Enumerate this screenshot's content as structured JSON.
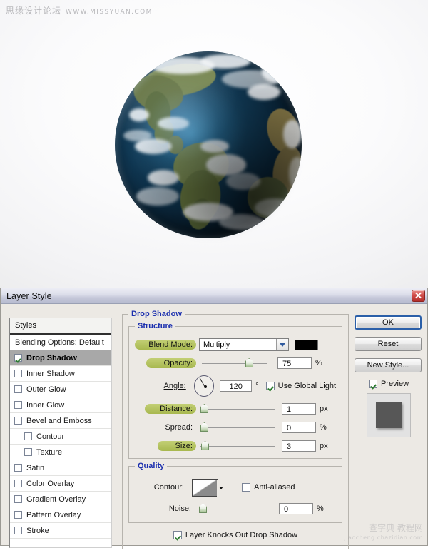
{
  "watermarks": {
    "top_text": "思缘设计论坛",
    "top_url": "WWW.MISSYUAN.COM",
    "bottom_text": "查字典 教程网",
    "bottom_url": "jiaocheng.chazidian.com"
  },
  "artwork": {
    "subject": "earth-globe",
    "description": "3D rendered Earth globe centered on the Americas"
  },
  "dialog": {
    "title": "Layer Style",
    "close_icon": "close-icon"
  },
  "styles_panel": {
    "header": "Styles",
    "blending_options": "Blending Options: Default",
    "items": [
      {
        "label": "Drop Shadow",
        "checked": true,
        "selected": true,
        "indent": false
      },
      {
        "label": "Inner Shadow",
        "checked": false,
        "selected": false,
        "indent": false
      },
      {
        "label": "Outer Glow",
        "checked": false,
        "selected": false,
        "indent": false
      },
      {
        "label": "Inner Glow",
        "checked": false,
        "selected": false,
        "indent": false
      },
      {
        "label": "Bevel and Emboss",
        "checked": false,
        "selected": false,
        "indent": false
      },
      {
        "label": "Contour",
        "checked": false,
        "selected": false,
        "indent": true
      },
      {
        "label": "Texture",
        "checked": false,
        "selected": false,
        "indent": true
      },
      {
        "label": "Satin",
        "checked": false,
        "selected": false,
        "indent": false
      },
      {
        "label": "Color Overlay",
        "checked": false,
        "selected": false,
        "indent": false
      },
      {
        "label": "Gradient Overlay",
        "checked": false,
        "selected": false,
        "indent": false
      },
      {
        "label": "Pattern Overlay",
        "checked": false,
        "selected": false,
        "indent": false
      },
      {
        "label": "Stroke",
        "checked": false,
        "selected": false,
        "indent": false
      }
    ]
  },
  "drop_shadow": {
    "section_title": "Drop Shadow",
    "structure": {
      "title": "Structure",
      "blend_mode_label": "Blend Mode:",
      "blend_mode_value": "Multiply",
      "shadow_color": "#000000",
      "opacity_label": "Opacity:",
      "opacity_value": "75",
      "opacity_unit": "%",
      "angle_label": "Angle:",
      "angle_value": "120",
      "angle_unit": "°",
      "use_global_light_label": "Use Global Light",
      "use_global_light_checked": true,
      "distance_label": "Distance:",
      "distance_value": "1",
      "distance_unit": "px",
      "spread_label": "Spread:",
      "spread_value": "0",
      "spread_unit": "%",
      "size_label": "Size:",
      "size_value": "3",
      "size_unit": "px"
    },
    "quality": {
      "title": "Quality",
      "contour_label": "Contour:",
      "contour_preset": "linear",
      "anti_aliased_label": "Anti-aliased",
      "anti_aliased_checked": false,
      "noise_label": "Noise:",
      "noise_value": "0",
      "noise_unit": "%"
    },
    "knockout_label": "Layer Knocks Out Drop Shadow",
    "knockout_checked": true
  },
  "buttons": {
    "ok": "OK",
    "reset": "Reset",
    "new_style": "New Style...",
    "preview_label": "Preview",
    "preview_checked": true
  },
  "colors": {
    "titlebar_accent": "#b6bacf",
    "group_title": "#1b2fae",
    "highlight_label": "#a8b84f",
    "close_button": "#b42e2b",
    "selected_row": "#a8a8a8"
  }
}
